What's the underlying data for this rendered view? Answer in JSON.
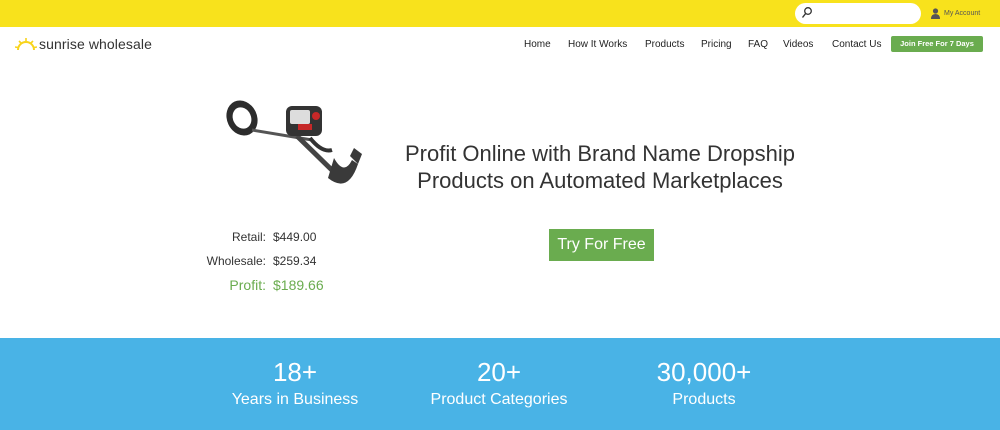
{
  "topbar": {
    "search_placeholder": "",
    "my_account": "My Account"
  },
  "brand": {
    "name": "sunrise wholesale",
    "accent": "#f8e21c",
    "green": "#6aac4f",
    "blue": "#49b3e6"
  },
  "nav": {
    "items": [
      "Home",
      "How It Works",
      "Products",
      "Pricing",
      "FAQ",
      "Videos",
      "Contact Us"
    ],
    "join_label": "Join Free For 7 Days"
  },
  "hero": {
    "headline": "Profit Online with Brand Name Dropship Products on Automated Marketplaces",
    "cta": "Try For Free",
    "prices": {
      "retail_label": "Retail:",
      "retail_value": "$449.00",
      "wholesale_label": "Wholesale:",
      "wholesale_value": "$259.34",
      "profit_label": "Profit:",
      "profit_value": "$189.66"
    }
  },
  "stats": [
    {
      "number": "18+",
      "label": "Years in Business"
    },
    {
      "number": "20+",
      "label": "Product Categories"
    },
    {
      "number": "30,000+",
      "label": "Products"
    }
  ]
}
